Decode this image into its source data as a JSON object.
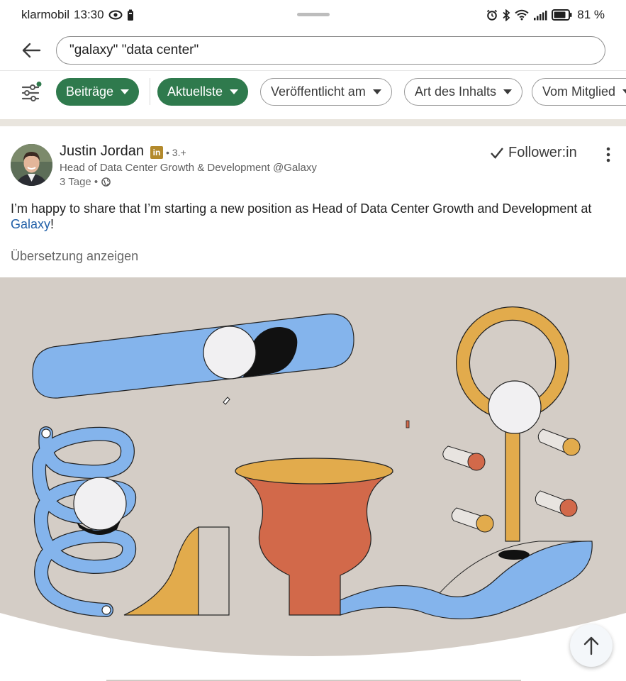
{
  "status_bar": {
    "carrier": "klarmobil",
    "time": "13:30",
    "battery_percent": "81 %"
  },
  "search": {
    "query": "\"galaxy\" \"data center\""
  },
  "filters": {
    "chips": [
      {
        "label": "Beiträge",
        "active": true
      },
      {
        "label": "Aktuellste",
        "active": true
      },
      {
        "label": "Veröffentlicht am",
        "active": false
      },
      {
        "label": "Art des Inhalts",
        "active": false
      },
      {
        "label": "Vom Mitglied",
        "active": false
      }
    ]
  },
  "post": {
    "author_name": "Justin Jordan",
    "badge": "in",
    "degree": "• 3.+",
    "headline": "Head of Data Center Growth & Development @Galaxy",
    "age": "3 Tage •",
    "follow_status": "Follower:in",
    "text_before": "I’m happy to share that I’m starting a new position as Head of Data Center Growth and Development at ",
    "mention": "Galaxy",
    "text_after": "!",
    "translate_label": "Übersetzung anzeigen"
  },
  "colors": {
    "brand_green": "#2f7a4d",
    "link_blue": "#2160a8",
    "image_bg": "#d4cdc6",
    "shape_blue": "#84b4ec",
    "shape_orange": "#d2694a",
    "shape_gold": "#e2ab4c"
  },
  "icons": {
    "back": "arrow-left-icon",
    "filter": "sliders-icon",
    "follow": "check-icon",
    "more": "more-vertical-icon",
    "scroll_top": "arrow-up-icon"
  }
}
